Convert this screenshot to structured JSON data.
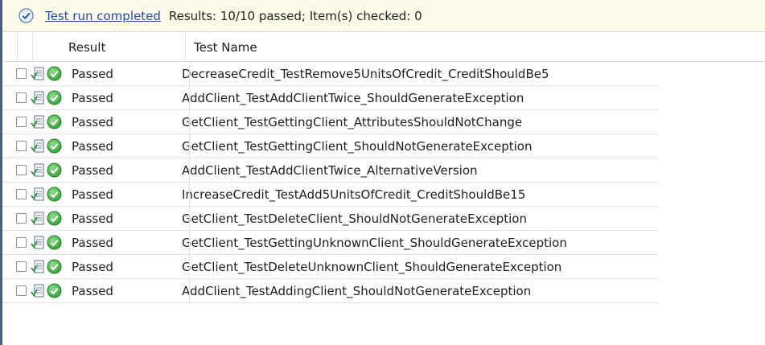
{
  "status": {
    "link": "Test run completed",
    "summary": "Results: 10/10 passed;  Item(s) checked: 0"
  },
  "columns": {
    "result": "Result",
    "test_name": "Test Name"
  },
  "rows": [
    {
      "result": "Passed",
      "name": "DecreaseCredit_TestRemove5UnitsOfCredit_CreditShouldBe5"
    },
    {
      "result": "Passed",
      "name": "AddClient_TestAddClientTwice_ShouldGenerateException"
    },
    {
      "result": "Passed",
      "name": "GetClient_TestGettingClient_AttributesShouldNotChange"
    },
    {
      "result": "Passed",
      "name": "GetClient_TestGettingClient_ShouldNotGenerateException"
    },
    {
      "result": "Passed",
      "name": "AddClient_TestAddClientTwice_AlternativeVersion"
    },
    {
      "result": "Passed",
      "name": "IncreaseCredit_TestAdd5UnitsOfCredit_CreditShouldBe15"
    },
    {
      "result": "Passed",
      "name": "GetClient_TestDeleteClient_ShouldNotGenerateException"
    },
    {
      "result": "Passed",
      "name": "GetClient_TestGettingUnknownClient_ShouldGenerateException"
    },
    {
      "result": "Passed",
      "name": "GetClient_TestDeleteUnknownClient_ShouldGenerateException"
    },
    {
      "result": "Passed",
      "name": "AddClient_TestAddingClient_ShouldNotGenerateException"
    }
  ],
  "colors": {
    "status_bg": "#fffbea",
    "link": "#1f4da8",
    "pass_green": "#3cae3c"
  },
  "icons": {
    "status": "check-circle-icon",
    "row_doc": "test-document-icon",
    "row_result": "passed-check-icon"
  }
}
